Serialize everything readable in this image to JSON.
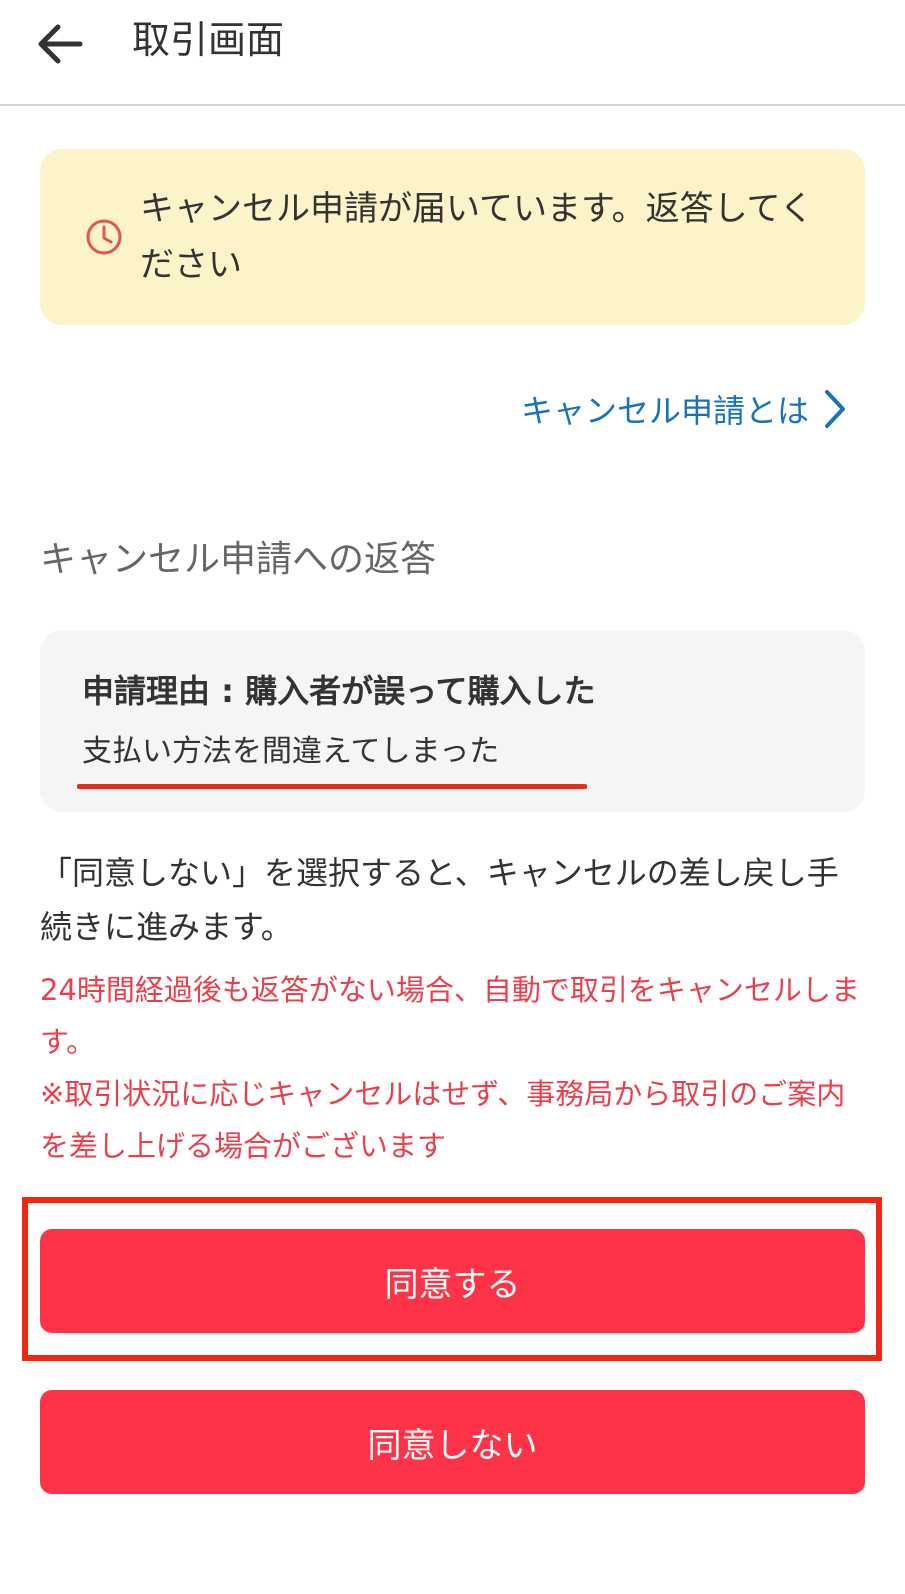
{
  "header": {
    "title": "取引画面",
    "back_icon": "arrow-left-icon"
  },
  "notice": {
    "icon": "clock-icon",
    "icon_color": "#e05555",
    "text": "キャンセル申請が届いています。返答してください",
    "background": "#fcf3c9"
  },
  "help_link": {
    "label": "キャンセル申請とは",
    "icon": "chevron-right-icon",
    "color": "#1a73b8"
  },
  "section": {
    "title": "キャンセル申請への返答"
  },
  "reason": {
    "label": "申請理由 : 購入者が誤って購入した",
    "detail": "支払い方法を間違えてしまった"
  },
  "description": "「同意しない」を選択すると、キャンセルの差し戻し手続きに進みます。",
  "warning": {
    "line1": "24時間経過後も返答がない場合、自動で取引をキャンセルします。",
    "line2": "※取引状況に応じキャンセルはせず、事務局から取引のご案内を差し上げる場合がございます",
    "color": "#e8414e"
  },
  "buttons": {
    "agree_label": "同意する",
    "disagree_label": "同意しない",
    "color": "#ff3347"
  }
}
